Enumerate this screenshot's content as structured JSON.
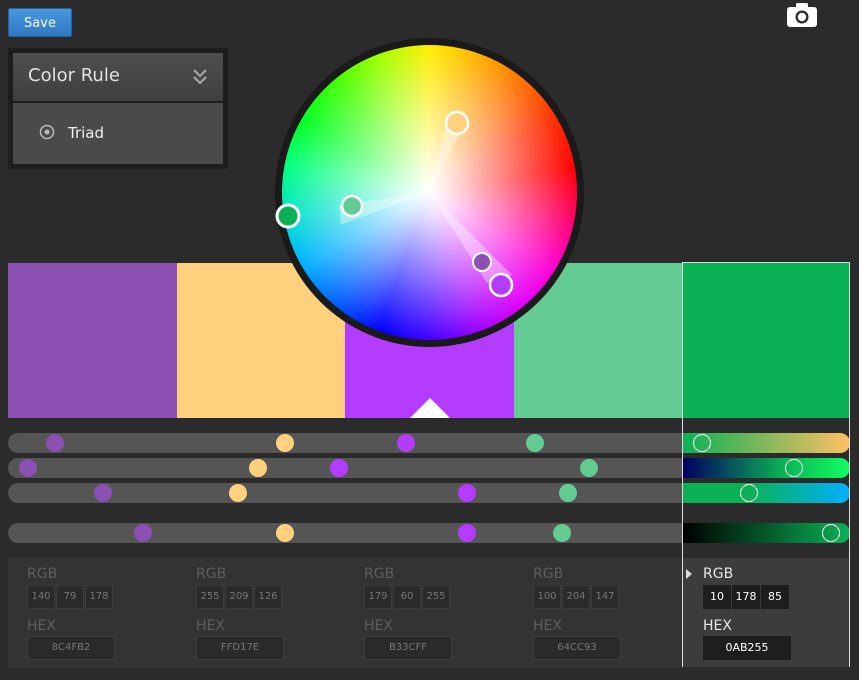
{
  "toolbar": {
    "save_label": "Save",
    "camera_icon": "camera-icon"
  },
  "rule": {
    "title": "Color Rule",
    "option": "Triad",
    "chevron_icon": "double-chevron-down-icon"
  },
  "swatches": [
    {
      "hex": "#8C4FB2",
      "rgb": [
        "140",
        "79",
        "178"
      ],
      "hex_text": "8C4FB2"
    },
    {
      "hex": "#FFD17E",
      "rgb": [
        "255",
        "209",
        "126"
      ],
      "hex_text": "FFD17E"
    },
    {
      "hex": "#B33CFF",
      "rgb": [
        "179",
        "60",
        "255"
      ],
      "hex_text": "B33CFF"
    },
    {
      "hex": "#64CC93",
      "rgb": [
        "100",
        "204",
        "147"
      ],
      "hex_text": "64CC93"
    },
    {
      "hex": "#0AB255",
      "rgb": [
        "10",
        "178",
        "85"
      ],
      "hex_text": "0AB255"
    }
  ],
  "labels": {
    "rgb": "RGB",
    "hex": "HEX"
  },
  "selected_index": 4,
  "sliders": {
    "row1": [
      0.07,
      0.41,
      0.59,
      0.78,
      0.02
    ],
    "row2": [
      0.03,
      0.37,
      0.49,
      0.86,
      0.67
    ],
    "row3": [
      0.14,
      0.34,
      0.68,
      0.83,
      0.35
    ],
    "row4": [
      0.2,
      0.41,
      0.68,
      0.82,
      0.93
    ]
  }
}
